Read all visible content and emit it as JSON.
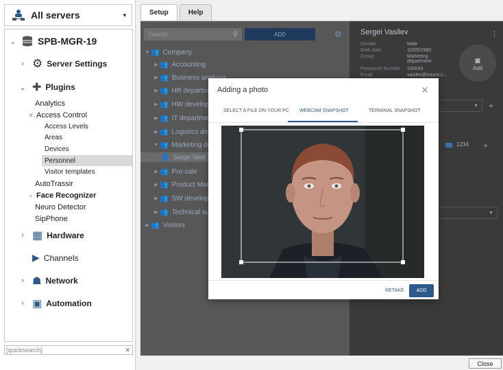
{
  "server_selector": {
    "label": "All servers"
  },
  "tree": {
    "server": "SPB-MGR-19",
    "items": [
      {
        "label": "Server Settings"
      },
      {
        "label": "Plugins"
      },
      {
        "label": "Analytics"
      },
      {
        "label": "Access Control"
      },
      {
        "label": "Access Levels"
      },
      {
        "label": "Areas"
      },
      {
        "label": "Devices"
      },
      {
        "label": "Personnel"
      },
      {
        "label": "Visitor templates"
      },
      {
        "label": "AutoTrassir"
      },
      {
        "label": "Face Recognizer"
      },
      {
        "label": "Neuro Detector"
      },
      {
        "label": "SipPhone"
      },
      {
        "label": "Hardware"
      },
      {
        "label": "Channels"
      },
      {
        "label": "Network"
      },
      {
        "label": "Automation"
      }
    ]
  },
  "quicksearch": {
    "placeholder": "[quicksearch]"
  },
  "tabs": [
    "Setup",
    "Help"
  ],
  "personnel": {
    "search_placeholder": "Search",
    "add_label": "ADD",
    "groups": [
      "Company",
      "Accounting",
      "Business analysis",
      "HR departme",
      "HW develop",
      "IT departmer",
      "Logistics dep",
      "Marketing de",
      "Sergei Vasil",
      "Pre-sale",
      "Product Man",
      "SW develop",
      "Technical sup",
      "Visitors"
    ]
  },
  "person": {
    "name": "Sergei Vasilev",
    "fields": [
      {
        "k": "Gender",
        "v": "Male"
      },
      {
        "k": "Birth date",
        "v": "10/05/1980"
      },
      {
        "k": "Group",
        "v": "Marketing department"
      },
      {
        "k": "Personnel Number",
        "v": "100043"
      },
      {
        "k": "Email",
        "v": "vasilev@trassir.c..."
      }
    ],
    "photo_add": "Add",
    "card": "1234"
  },
  "modal": {
    "title": "Adding a photo",
    "tabs": [
      "SELECT A FILE ON YOUR PC",
      "WEBCAM SNAPSHOT",
      "TERMINAL SNAPSHOT"
    ],
    "retake": "RETAKE",
    "add": "ADD"
  },
  "close_label": "Close"
}
